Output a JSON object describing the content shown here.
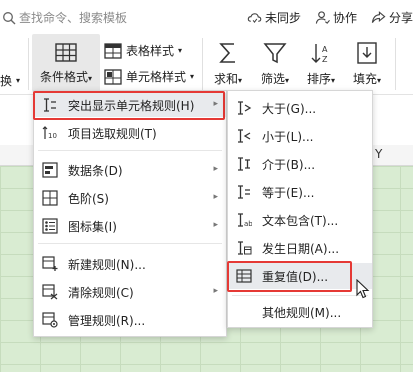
{
  "search": {
    "placeholder": "查找命令、搜索模板"
  },
  "top_actions": {
    "sync": "未同步",
    "collab": "协作",
    "share": "分享"
  },
  "ribbon": {
    "cond_format": "条件格式",
    "table_style": "表格样式",
    "cell_style": "单元格样式",
    "sum": "求和",
    "filter": "筛选",
    "sort": "排序",
    "fill": "填充",
    "left_cut": "换",
    "dropdown_glyph": "▾"
  },
  "column_header": "Y",
  "main_menu": {
    "items": [
      {
        "label": "突出显示单元格规则(H)",
        "icon": "highlight-rules-icon",
        "submenu": true
      },
      {
        "label": "项目选取规则(T)",
        "icon": "top-bottom-rules-icon",
        "submenu": true
      },
      {
        "label": "数据条(D)",
        "icon": "data-bars-icon",
        "submenu": true
      },
      {
        "label": "色阶(S)",
        "icon": "color-scales-icon",
        "submenu": true
      },
      {
        "label": "图标集(I)",
        "icon": "icon-sets-icon",
        "submenu": true
      },
      {
        "label": "新建规则(N)...",
        "icon": "new-rule-icon",
        "submenu": false
      },
      {
        "label": "清除规则(C)",
        "icon": "clear-rules-icon",
        "submenu": true
      },
      {
        "label": "管理规则(R)...",
        "icon": "manage-rules-icon",
        "submenu": false
      }
    ]
  },
  "sub_menu": {
    "items": [
      {
        "label": "大于(G)...",
        "icon": "greater-than-icon"
      },
      {
        "label": "小于(L)...",
        "icon": "less-than-icon"
      },
      {
        "label": "介于(B)...",
        "icon": "between-icon"
      },
      {
        "label": "等于(E)...",
        "icon": "equal-to-icon"
      },
      {
        "label": "文本包含(T)...",
        "icon": "text-contains-icon"
      },
      {
        "label": "发生日期(A)...",
        "icon": "date-occurring-icon"
      },
      {
        "label": "重复值(D)...",
        "icon": "duplicate-values-icon"
      },
      {
        "label": "其他规则(M)...",
        "icon": ""
      }
    ]
  },
  "colors": {
    "highlight_border": "#e53935",
    "grid_fill": "#d9ecd2"
  }
}
